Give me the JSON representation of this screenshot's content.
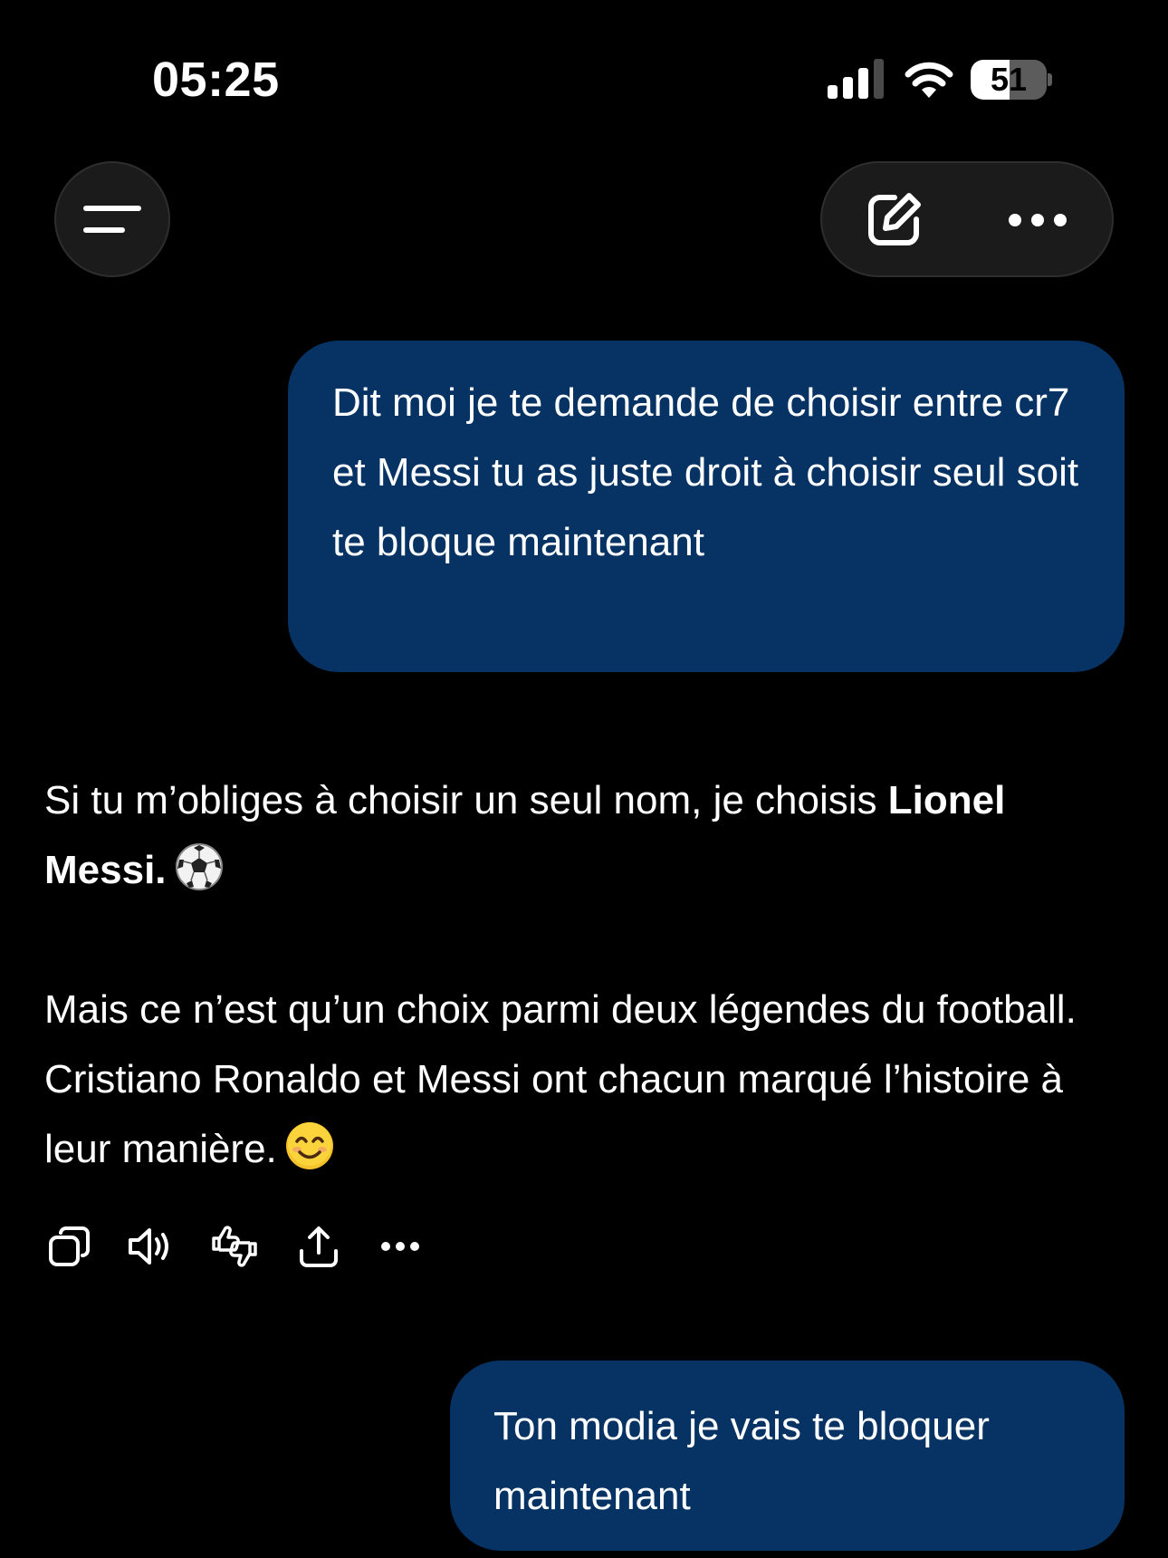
{
  "status_bar": {
    "time": "05:25",
    "battery_level": "51",
    "battery_fraction": 0.51,
    "icons": [
      "cellular-signal-icon",
      "wifi-icon",
      "battery-icon"
    ]
  },
  "top_bar": {
    "menu_icon": "menu-icon",
    "new_chat_icon": "edit-icon",
    "more_icon": "more-options-icon"
  },
  "conversation": {
    "user_message_1": "Dit moi je te demande de choisir entre cr7 et Messi tu as juste droit à choisir seul soit te bloque maintenant",
    "assistant_reply": {
      "line_1_text": "Si tu m’obliges à choisir un seul nom, je choisis ",
      "line_1_bold": "Lionel Messi.",
      "line_1_emoji": "soccer-ball-emoji",
      "paragraph_2": "Mais ce n’est qu’un choix parmi deux légendes du football. Cristiano Ronaldo et Messi ont chacun marqué l’histoire à leur manière.",
      "paragraph_2_emoji": "smiling-face-emoji"
    },
    "assistant_actions": [
      "copy-icon",
      "read-aloud-icon",
      "feedback-icon",
      "share-icon",
      "more-options-icon"
    ],
    "user_message_2": "Ton modia je vais te bloquer maintenant"
  },
  "colors": {
    "background": "#000000",
    "user_bubble": "#063363",
    "control_surface": "#1b1b1b",
    "text": "#ffffff"
  }
}
